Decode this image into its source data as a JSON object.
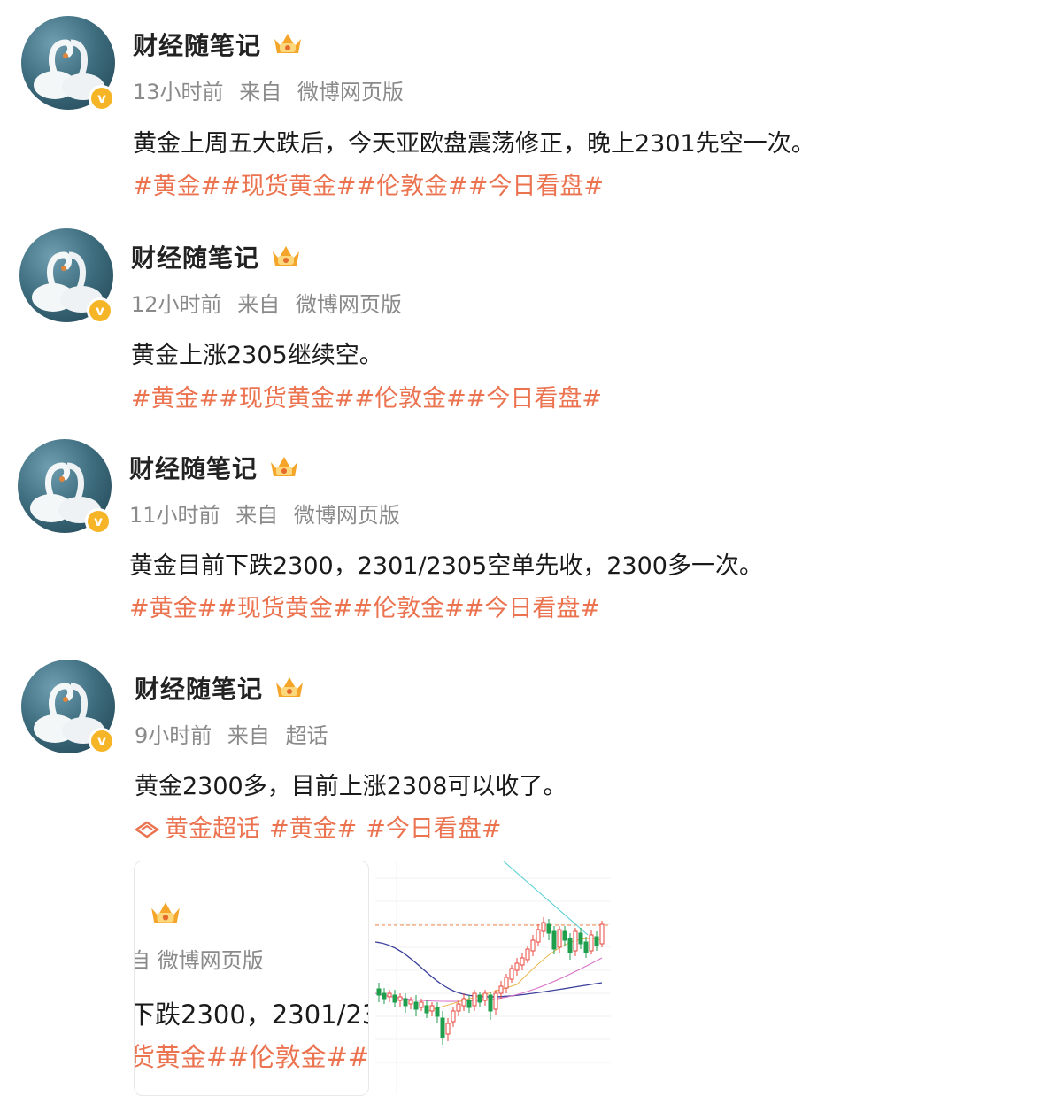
{
  "posts": [
    {
      "author": "财经随笔记",
      "time": "13小时前",
      "from_label": "来自",
      "source": "微博网页版",
      "text": "黄金上周五大跌后，今天亚欧盘震荡修正，晚上2301先空一次。",
      "tags": [
        "#黄金#",
        "#现货黄金#",
        "#伦敦金#",
        "#今日看盘#"
      ]
    },
    {
      "author": "财经随笔记",
      "time": "12小时前",
      "from_label": "来自",
      "source": "微博网页版",
      "text": "黄金上涨2305继续空。",
      "tags": [
        "#黄金#",
        "#现货黄金#",
        "#伦敦金#",
        "#今日看盘#"
      ]
    },
    {
      "author": "财经随笔记",
      "time": "11小时前",
      "from_label": "来自",
      "source": "微博网页版",
      "text": "黄金目前下跌2300，2301/2305空单先收，2300多一次。",
      "tags": [
        "#黄金#",
        "#现货黄金#",
        "#伦敦金#",
        "#今日看盘#"
      ]
    },
    {
      "author": "财经随笔记",
      "time": "9小时前",
      "from_label": "来自",
      "source": "超话",
      "text": "黄金2300多，目前上涨2308可以收了。",
      "supertopic": "黄金超话",
      "tags": [
        "#黄金#",
        "#今日看盘#"
      ],
      "attachment_card": {
        "line_meta": "自 微博网页版",
        "line_text": "下跌2300，2301/23",
        "line_tags": "货黄金##伦敦金##"
      }
    }
  ],
  "colors": {
    "tag": "#eb7350",
    "meta": "#8a8a8a",
    "verified_badge": "#f6b526",
    "chart_up": "#e8473d",
    "chart_down": "#1f9e4c"
  },
  "icons": {
    "avatar": "swan-avatar",
    "verified": "verified-badge-icon",
    "crown": "crown-badge-icon",
    "supertopic": "diamond-icon"
  }
}
